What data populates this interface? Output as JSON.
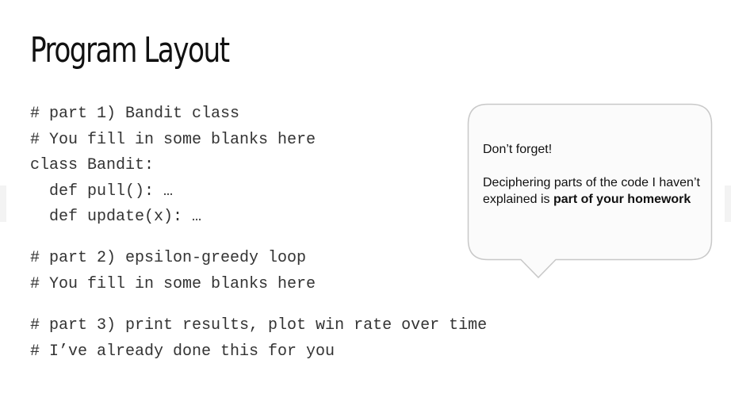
{
  "slide": {
    "title": "Program Layout",
    "code_blocks": [
      {
        "lines": [
          "# part 1) Bandit class",
          "# You fill in some blanks here",
          "class Bandit:",
          "  def pull(): …",
          "  def update(x): …"
        ]
      },
      {
        "lines": [
          "# part 2) epsilon-greedy loop",
          "# You fill in some blanks here"
        ]
      },
      {
        "lines": [
          "# part 3) print results, plot win rate over time",
          "# I’ve already done this for you"
        ]
      }
    ],
    "callout": {
      "heading": "Don’t forget!",
      "body_prefix": "Deciphering parts of the code I haven’t explained is ",
      "body_emphasis": "part of your homework"
    },
    "colors": {
      "background": "#ffffff",
      "text": "#333333",
      "callout_border": "#c8c8c8",
      "callout_fill": "#fbfbfb"
    }
  }
}
